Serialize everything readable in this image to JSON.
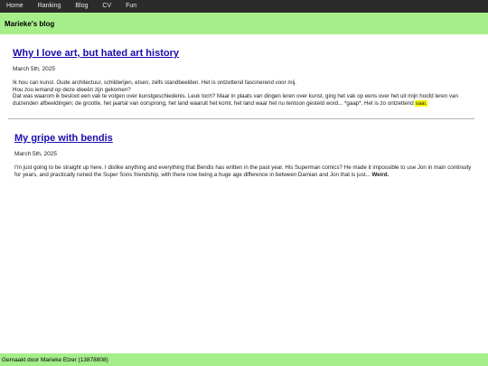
{
  "nav": {
    "items": [
      "Home",
      "Ranking",
      "Blog",
      "CV",
      "Fun"
    ]
  },
  "blog": {
    "title": "Marieke's blog"
  },
  "posts": [
    {
      "title": "Why I love art, but hated art history",
      "date": "March 5th, 2025",
      "lines": [
        "Ik hou can kunst. Oude architectuur, schilderijen, etsen, zelfs standbeelden. Het is ontzettend fascinerend voor mij.",
        "Hou zou iemand op deze ideeën zijn gekomen?",
        "Dat was waarom ik besloot een vak te volgen over kunstgeschiedenis. Leuk toch? Maar in plaats van dingen leren over kunst, ging het vak op eens over het uit mijn hoofd leren van duizenden afbeeldingen; de grootte, het jaartal van oorsprong, het land waaruit het komt, het land waar het nu tentoon gesteld word... *gaap*. Het is zo ontzettend"
      ],
      "highlight": "saai."
    },
    {
      "title": "My gripe with bendis",
      "date": "March 5th, 2025",
      "body": "I'm just going to be straight up here. I dislike anything and everything that Bendis has written in the past year. His Superman comics? He made it impossible to use Jon in main continuity for years, and practically ruined the Super Sons friendship, with there now being a huge age difference in between Damian and Jon that is just...",
      "emphasis": "Weird."
    }
  ],
  "footer": {
    "text": "Gemaakt door Marieke Elzer (13878808)"
  },
  "colors": {
    "nav_bg": "#2b2b2b",
    "accent_green": "#a6ee8a",
    "link_blue": "#1a0dab",
    "highlight": "#ffff00"
  }
}
